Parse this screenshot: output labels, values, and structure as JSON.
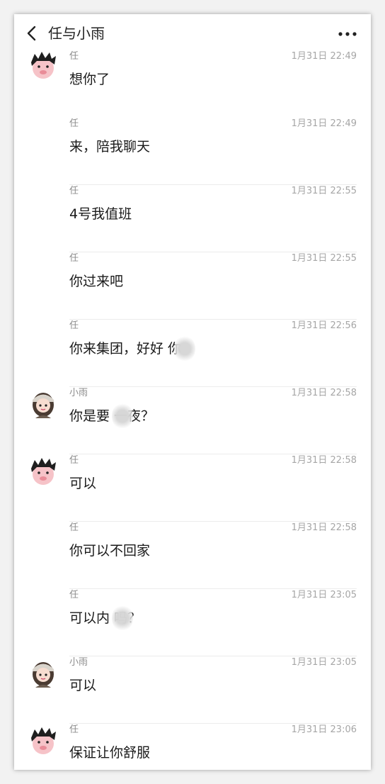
{
  "header": {
    "title": "任与小雨"
  },
  "colors": {
    "background": "#ffffff",
    "text_primary": "#1a1a1a",
    "text_secondary": "#a6a6a6"
  },
  "messages": [
    {
      "sender": "任",
      "time": "1月31日 22:49",
      "text": "想你了",
      "avatar": "male-avatar-icon"
    },
    {
      "sender": "任",
      "time": "1月31日 22:49",
      "text": "来，陪我聊天"
    },
    {
      "sender": "任",
      "time": "1月31日 22:55",
      "text": "4号我值班"
    },
    {
      "sender": "任",
      "time": "1月31日 22:55",
      "text": "你过来吧"
    },
    {
      "sender": "任",
      "time": "1月31日 22:56",
      "text": "你来集团，好好  你"
    },
    {
      "sender": "小雨",
      "time": "1月31日 22:58",
      "text": "你是要  一夜？",
      "avatar": "female-avatar-icon"
    },
    {
      "sender": "任",
      "time": "1月31日 22:58",
      "text": "可以",
      "avatar": "male-avatar-icon"
    },
    {
      "sender": "任",
      "time": "1月31日 22:58",
      "text": "你可以不回家"
    },
    {
      "sender": "任",
      "time": "1月31日 23:05",
      "text": "可以内  吗？"
    },
    {
      "sender": "小雨",
      "time": "1月31日 23:05",
      "text": "可以",
      "avatar": "female-avatar-icon"
    },
    {
      "sender": "任",
      "time": "1月31日 23:06",
      "text": "保证让你舒服",
      "avatar": "male-avatar-icon"
    }
  ]
}
